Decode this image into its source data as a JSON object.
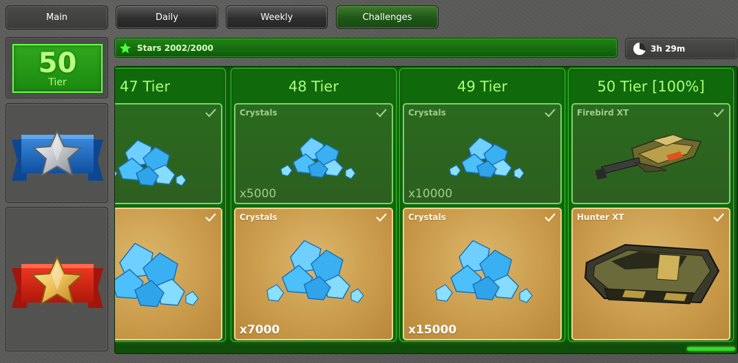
{
  "nav": {
    "main": "Main",
    "daily": "Daily",
    "weekly": "Weekly",
    "challenges": "Challenges",
    "active": "Challenges"
  },
  "tier": {
    "number": "50",
    "label": "Tier"
  },
  "badges": {
    "free": "silver-star-badge",
    "premium": "gold-star-badge"
  },
  "stars": {
    "text": "Stars 2002/2000",
    "icon": "star-icon"
  },
  "timer": {
    "text": "3h 29m",
    "icon": "clock-icon"
  },
  "colors": {
    "accent_green": "#2ecb22",
    "tier_green": "#1b8a10",
    "title_green": "#aaff7a",
    "premium_gold": "#c99a4a"
  },
  "tiers": [
    {
      "title": "47 Tier",
      "free": {
        "name": "",
        "amount": "",
        "icon": "crystals-icon",
        "claimed": true
      },
      "premium": {
        "name": "",
        "amount": "",
        "icon": "crystals-icon",
        "claimed": true
      }
    },
    {
      "title": "48 Tier",
      "free": {
        "name": "Crystals",
        "amount": "x5000",
        "icon": "crystals-icon",
        "claimed": true
      },
      "premium": {
        "name": "Crystals",
        "amount": "x7000",
        "icon": "crystals-icon",
        "claimed": true
      }
    },
    {
      "title": "49 Tier",
      "free": {
        "name": "Crystals",
        "amount": "x10000",
        "icon": "crystals-icon",
        "claimed": true
      },
      "premium": {
        "name": "Crystals",
        "amount": "x15000",
        "icon": "crystals-icon",
        "claimed": true
      }
    },
    {
      "title": "50 Tier [100%]",
      "free": {
        "name": "Firebird XT",
        "amount": "",
        "icon": "firebird-turret-icon",
        "claimed": true
      },
      "premium": {
        "name": "Hunter XT",
        "amount": "",
        "icon": "hunter-hull-icon",
        "claimed": true
      }
    }
  ]
}
